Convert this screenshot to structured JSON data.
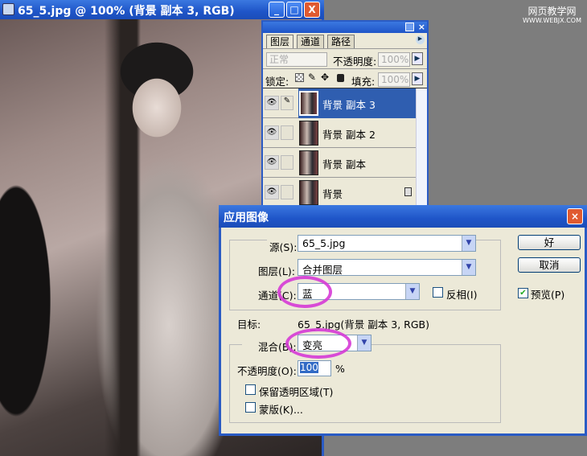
{
  "document": {
    "title": "65_5.jpg @ 100% (背景 副本 3, RGB)",
    "minimize": "_",
    "maximize": "□",
    "close": "X"
  },
  "watermark": {
    "line1": "网页教学网",
    "line2": "WWW.WEBJX.COM"
  },
  "layers_panel": {
    "tabs": [
      "图层",
      "通道",
      "路径"
    ],
    "blend_mode": "正常",
    "opacity_label": "不透明度:",
    "opacity": "100%",
    "lock_label": "锁定:",
    "fill_label": "填充:",
    "fill": "100%",
    "layers": [
      {
        "name": "背景 副本 3",
        "selected": true
      },
      {
        "name": "背景 副本 2"
      },
      {
        "name": "背景 副本"
      },
      {
        "name": "背景",
        "locked": true
      }
    ]
  },
  "dialog": {
    "title": "应用图像",
    "source_label": "源(S):",
    "source": "65_5.jpg",
    "layer_label": "图层(L):",
    "layer": "合并图层",
    "channel_label": "通道(C):",
    "channel": "蓝",
    "invert_label": "反相(I)",
    "invert": false,
    "target_label": "目标:",
    "target": "65_5.jpg(背景 副本 3, RGB)",
    "blend_label": "混合(B):",
    "blend": "变亮",
    "opacity_label": "不透明度(O):",
    "opacity": "100",
    "percent": "%",
    "preserve_label": "保留透明区域(T)",
    "preserve": false,
    "mask_label": "蒙版(K)...",
    "mask": false,
    "ok": "好",
    "cancel": "取消",
    "preview_label": "预览(P)",
    "preview": true,
    "highlight_color": "#d63ad6"
  }
}
